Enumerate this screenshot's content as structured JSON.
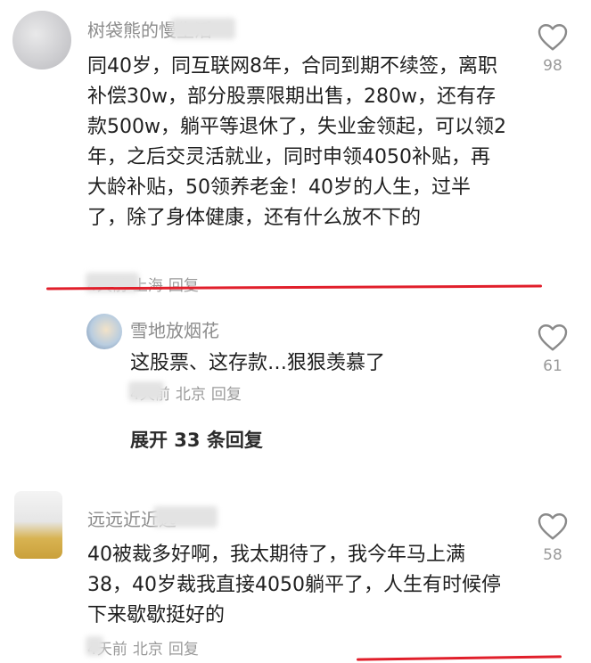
{
  "comments": [
    {
      "username": "树袋熊的慢生活",
      "content": "同40岁，同互联网8年，合同到期不续签，离职补偿30w，部分股票限期出售，280w，还有存款500w，躺平等退休了，失业金领起，可以领2年，之后交灵活就业，同时申领4050补贴，再大龄补贴，50领养老金！40岁的人生，过半了，除了身体健康，还有什么放不下的",
      "time": "4天前",
      "location": "上海",
      "reply": "回复",
      "likes": "98"
    },
    {
      "username": "雪地放烟花",
      "content": "这股票、这存款…狠狠羡慕了",
      "time": "4天前",
      "location": "北京",
      "reply": "回复",
      "likes": "61"
    },
    {
      "username": "远远近近远",
      "content": "40被裁多好啊，我太期待了，我今年马上满38，40岁裁我直接4050躺平了，人生有时候停下来歇歇挺好的",
      "time": "4天前",
      "location": "北京",
      "reply": "回复",
      "likes": "58"
    }
  ],
  "expand_replies": "展开 33 条回复",
  "icons": {
    "like": "heart-outline-icon"
  },
  "colors": {
    "underline": "#e11f2b",
    "meta_text": "#9a9a9a",
    "username": "#8c8c8c"
  }
}
